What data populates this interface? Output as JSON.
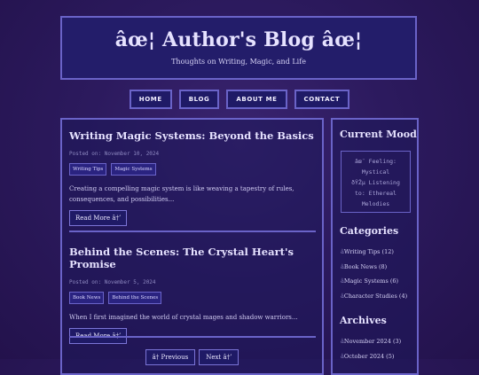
{
  "header": {
    "title": "âœ¦ Author's Blog âœ¦",
    "tagline": "Thoughts on Writing, Magic, and Life"
  },
  "nav": [
    "HOME",
    "BLOG",
    "ABOUT ME",
    "CONTACT"
  ],
  "posts": [
    {
      "title": "Writing Magic Systems: Beyond the Basics",
      "date": "Posted on: November 10, 2024",
      "tags": [
        "Writing Tips",
        "Magic Systems"
      ],
      "excerpt": "Creating a compelling magic system is like weaving a tapestry of rules, consequences, and possibilities...",
      "read_more": "Read More â†’"
    },
    {
      "title": "Behind the Scenes: The Crystal Heart's Promise",
      "date": "Posted on: November 5, 2024",
      "tags": [
        "Book News",
        "Behind the Scenes"
      ],
      "excerpt": "When I first imagined the world of crystal mages and shadow warriors...",
      "read_more": "Read More â†’"
    }
  ],
  "pagination": {
    "previous": "â† Previous",
    "next": "Next â†’"
  },
  "sidebar": {
    "mood_title": "Current Mood",
    "mood_lines": [
      "âœ¨ Feeling:",
      "Mystical",
      "ðŸŽµ Listening",
      "to: Ethereal",
      "Melodies"
    ],
    "categories_title": "Categories",
    "categories": [
      {
        "bullet": "â",
        "label": "Writing Tips (12)"
      },
      {
        "bullet": "â",
        "label": "Book News (8)"
      },
      {
        "bullet": "â",
        "label": "Magic Systems (6)"
      },
      {
        "bullet": "â",
        "label": "Character Studies (4)"
      }
    ],
    "archives_title": "Archives",
    "archives": [
      {
        "bullet": "â",
        "label": "November 2024 (3)"
      },
      {
        "bullet": "â",
        "label": "October 2024 (5)"
      }
    ]
  },
  "colors": {
    "background": "#2c1a5e",
    "panel_border": "#6a63c8",
    "panel_fill": "#231d6a",
    "text": "#e6e2ff"
  }
}
